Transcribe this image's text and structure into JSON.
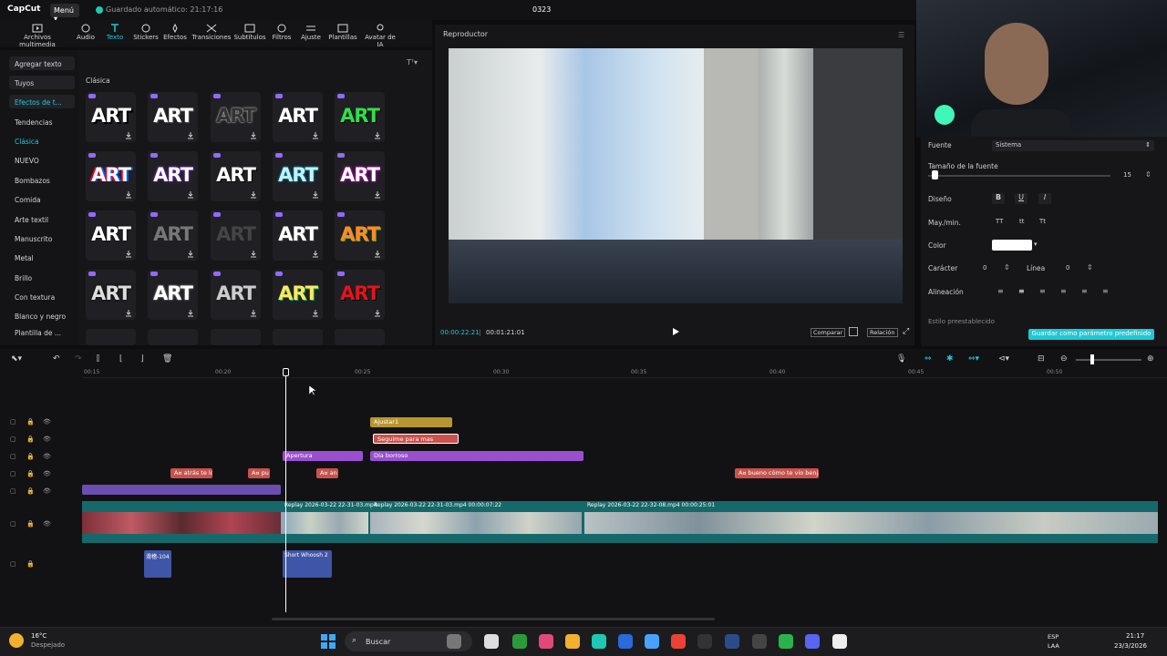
{
  "titlebar": {
    "app": "CapCut",
    "menu": "Menú",
    "autosave": "Guardado automático: 21:17:16",
    "project": "0323"
  },
  "toolbar": {
    "items": [
      "Archivos multimedia",
      "Audio",
      "Texto",
      "Stickers",
      "Efectos",
      "Transiciones",
      "Subtítulos",
      "Filtros",
      "Ajuste",
      "Plantillas",
      "Avatar de IA"
    ],
    "active": "Texto"
  },
  "leftnav": {
    "items": [
      "Agregar texto",
      "Tuyos",
      "Efectos de t...",
      "Tendencias",
      "Clásica",
      "NUEVO",
      "Bombazos",
      "Comida",
      "Arte textil",
      "Manuscrito",
      "Metal",
      "Brillo",
      "Con textura",
      "Blanco y negro",
      "Plantilla de ..."
    ]
  },
  "assets": {
    "section": "Clásica",
    "card_text": "ART"
  },
  "player": {
    "title": "Reproductor",
    "time_current": "00:00:22:21",
    "time_total": "00:01:21:01",
    "btn_compare": "Comparar",
    "btn_ratio": "Relación"
  },
  "props": {
    "font_label": "Fuente",
    "font_value": "Sistema",
    "size_label": "Tamaño de la fuente",
    "size_value": "15",
    "style_label": "Diseño",
    "style_b": "B",
    "style_u": "U",
    "style_i": "I",
    "case_label": "May./min.",
    "case_tt1": "TT",
    "case_tt2": "tt",
    "case_tt3": "Tt",
    "color_label": "Color",
    "char_label": "Carácter",
    "char_value": "0",
    "line_label": "Línea",
    "line_value": "0",
    "align_label": "Alineación",
    "preset_label": "Estilo preestablecido",
    "save_default": "Guardar como parámetro predefinido"
  },
  "timeline": {
    "ticks": [
      "00:15",
      "00:20",
      "00:25",
      "00:30",
      "00:35",
      "00:40",
      "00:45",
      "00:50"
    ],
    "clips": {
      "ajustar": "Ajustar1",
      "seguime": "Seguime para mas",
      "apertura": "Apertura",
      "dia": "Día borroso",
      "t1": "A¤ atrás te lo",
      "t2": "A¤ pu",
      "t3": "A¤ an",
      "t4": "A¤ bueno cómo te vio benja",
      "v1": "Replay 2026-03-22 22-31-03.mp4",
      "v2": "Replay 2026-03-22 22-31-03.mp4  00:00:07:22",
      "v3": "Replay 2026-03-22 22-32-08.mp4  00:00:25:01",
      "a1": "滑稽-104",
      "a2": "Short Whoosh 2"
    }
  },
  "taskbar": {
    "weather_temp": "16°C",
    "weather_desc": "Despejado",
    "search": "Buscar",
    "lang1": "ESP",
    "lang2": "LAA",
    "time": "21:17",
    "date": "23/3/2026"
  },
  "colors": {
    "accent": "#1ec9d6",
    "text_clip": "#c9524c",
    "effect_clip": "#9a4fcf",
    "adjust_clip": "#b8962e",
    "video_track": "#1e8c8a",
    "audio_clip": "#3f55a8"
  }
}
